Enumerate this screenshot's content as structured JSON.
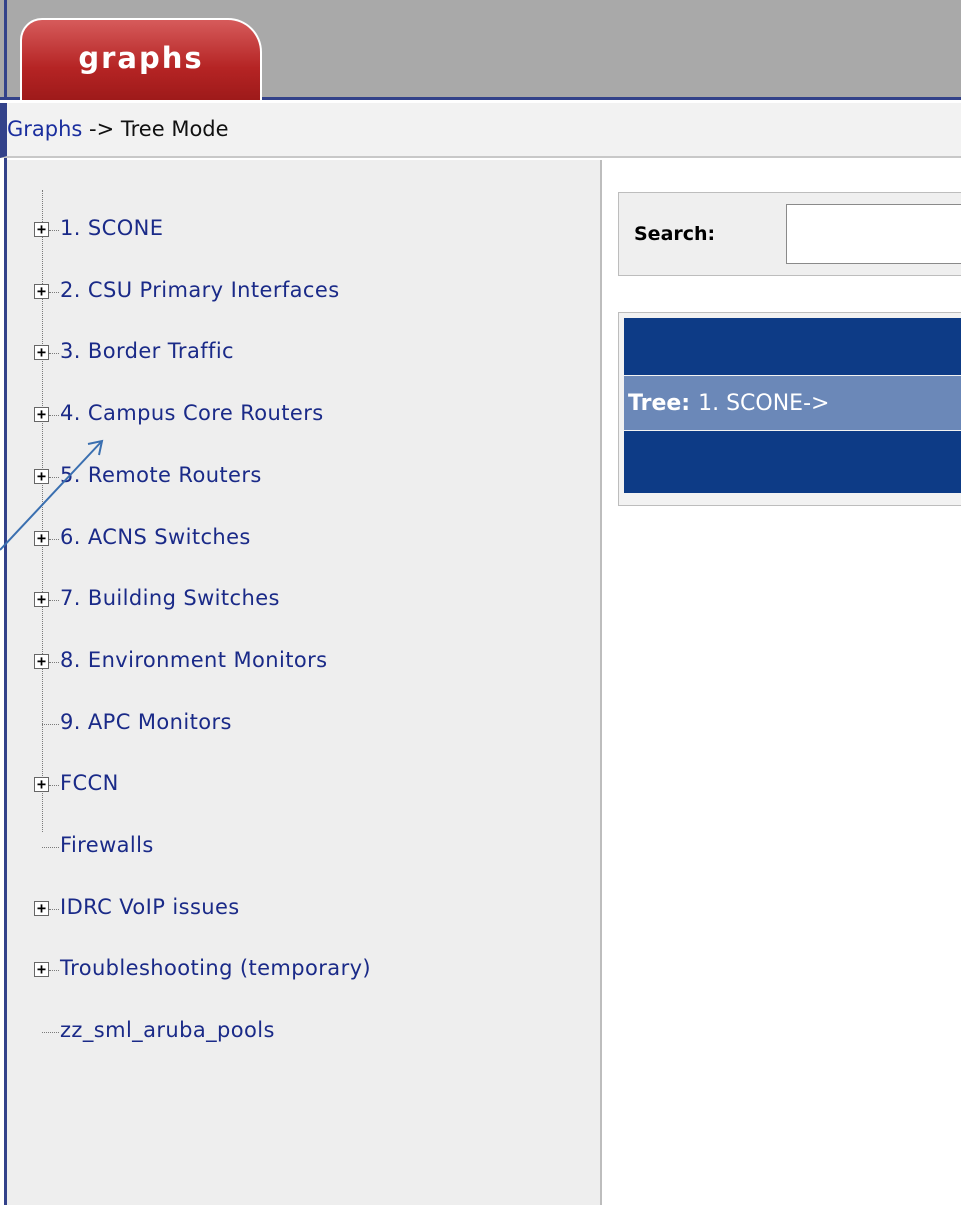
{
  "tab": {
    "label": "graphs"
  },
  "breadcrumb": {
    "link": "Graphs",
    "separator": " -> ",
    "current": "Tree Mode"
  },
  "tree": {
    "items": [
      {
        "label": "1. SCONE",
        "expandable": true
      },
      {
        "label": "2. CSU Primary Interfaces",
        "expandable": true
      },
      {
        "label": "3. Border Traffic",
        "expandable": true
      },
      {
        "label": "4. Campus Core Routers",
        "expandable": true
      },
      {
        "label": "5. Remote Routers",
        "expandable": true
      },
      {
        "label": "6. ACNS Switches",
        "expandable": true
      },
      {
        "label": "7. Building Switches",
        "expandable": true
      },
      {
        "label": "8. Environment Monitors",
        "expandable": true
      },
      {
        "label": "9. APC Monitors",
        "expandable": false
      },
      {
        "label": "FCCN",
        "expandable": true
      },
      {
        "label": "Firewalls",
        "expandable": false
      },
      {
        "label": "IDRC VoIP issues",
        "expandable": true
      },
      {
        "label": "Troubleshooting (temporary)",
        "expandable": true
      },
      {
        "label": "zz_sml_aruba_pools",
        "expandable": false
      }
    ]
  },
  "search": {
    "label": "Search:",
    "value": ""
  },
  "tree_path": {
    "label": "Tree:",
    "value": "1. SCONE->"
  },
  "colors": {
    "tab": "#b52424",
    "header_bar": "#0d3b86",
    "tree_path_row": "#6b88b8",
    "link": "#1a2a88",
    "annotation_arrow": "#3a6fb0"
  }
}
